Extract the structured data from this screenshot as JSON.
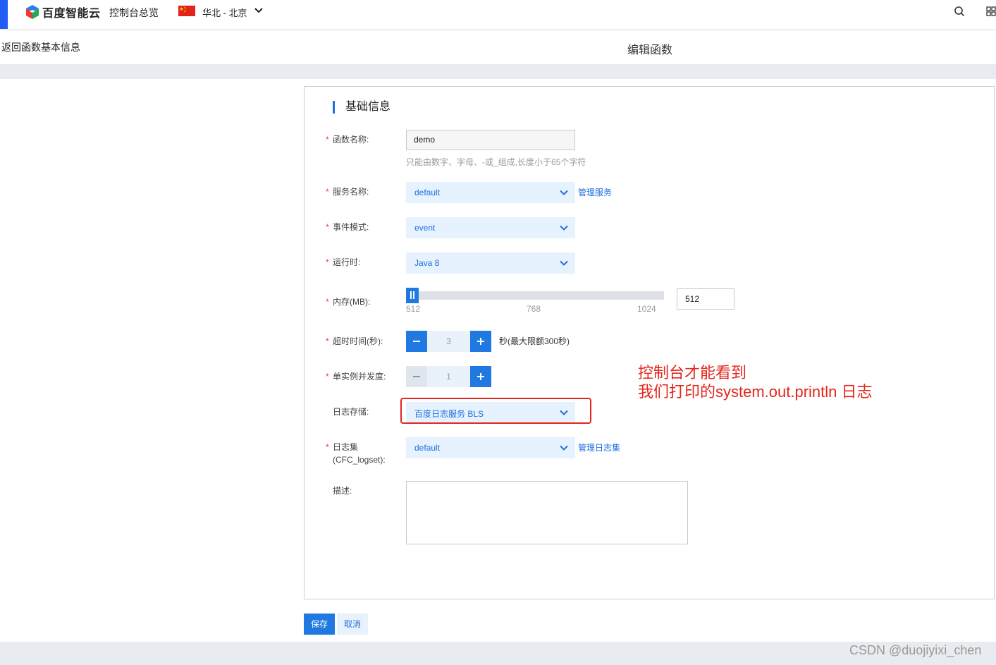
{
  "header": {
    "brand": "百度智能云",
    "console_link": "控制台总览",
    "region": "华北 - 北京"
  },
  "subheader": {
    "back_link": "返回函数基本信息",
    "page_title": "编辑函数"
  },
  "form": {
    "section_title": "基础信息",
    "required_mark": "*",
    "function_name": {
      "label": "函数名称:",
      "value": "demo",
      "hint": "只能由数字、字母、-或_组成,长度小于65个字符"
    },
    "service_name": {
      "label": "服务名称:",
      "value": "default",
      "link": "管理服务"
    },
    "event_mode": {
      "label": "事件模式:",
      "value": "event"
    },
    "runtime": {
      "label": "运行时:",
      "value": "Java 8"
    },
    "memory": {
      "label": "内存(MB):",
      "ticks": [
        "512",
        "768",
        "1024"
      ],
      "value": "512",
      "slider_fraction": 0
    },
    "timeout": {
      "label": "超时时间(秒):",
      "value": "3",
      "note": "秒(最大限额300秒)"
    },
    "concurrency": {
      "label": "单实例并发度:",
      "value": "1"
    },
    "log_storage": {
      "label": "日志存储:",
      "value": "百度日志服务 BLS"
    },
    "logset": {
      "label_line1": "日志集",
      "label_line2": "(CFC_logset):",
      "value": "default",
      "link": "管理日志集"
    },
    "description": {
      "label": "描述:",
      "value": ""
    }
  },
  "actions": {
    "save": "保存",
    "cancel": "取消"
  },
  "annotation": {
    "line1": "控制台才能看到",
    "line2": "我们打印的system.out.println 日志"
  },
  "watermark": "CSDN @duojiyixi_chen",
  "colors": {
    "primary": "#1f79e0",
    "link": "#1f6fe0",
    "select_bg": "#e6f2fd",
    "required": "#e6422d",
    "annotation": "#e3261c",
    "top_accent": "#1f5df5"
  }
}
